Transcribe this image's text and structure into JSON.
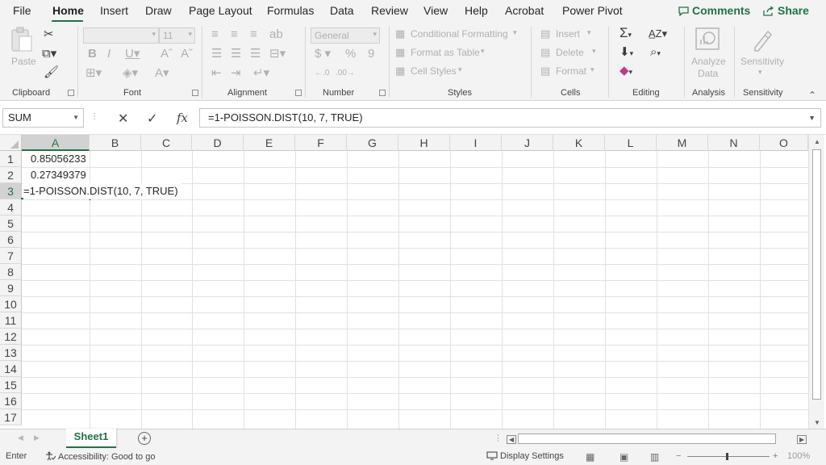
{
  "menu": {
    "tabs": [
      "File",
      "Home",
      "Insert",
      "Draw",
      "Page Layout",
      "Formulas",
      "Data",
      "Review",
      "View",
      "Help",
      "Acrobat",
      "Power Pivot"
    ],
    "active": "Home",
    "comments": "Comments",
    "share": "Share"
  },
  "ribbon": {
    "clipboard": {
      "label": "Clipboard",
      "paste": "Paste"
    },
    "font": {
      "label": "Font",
      "size": "11"
    },
    "alignment": {
      "label": "Alignment"
    },
    "number": {
      "label": "Number",
      "format": "General"
    },
    "styles": {
      "label": "Styles",
      "conditional": "Conditional Formatting",
      "format_table": "Format as Table",
      "cell_styles": "Cell Styles"
    },
    "cells": {
      "label": "Cells",
      "insert": "Insert",
      "delete": "Delete",
      "format": "Format"
    },
    "editing": {
      "label": "Editing"
    },
    "analysis": {
      "label": "Analysis",
      "analyze_data_line1": "Analyze",
      "analyze_data_line2": "Data"
    },
    "sensitivity": {
      "label": "Sensitivity",
      "button": "Sensitivity"
    }
  },
  "formula_bar": {
    "name_box": "SUM",
    "formula": "=1-POISSON.DIST(10, 7, TRUE)"
  },
  "grid": {
    "columns": [
      "A",
      "B",
      "C",
      "D",
      "E",
      "F",
      "G",
      "H",
      "I",
      "J",
      "K",
      "L",
      "M",
      "N",
      "O"
    ],
    "rows": [
      "1",
      "2",
      "3",
      "4",
      "5",
      "6",
      "7",
      "8",
      "9",
      "10",
      "11",
      "12",
      "13",
      "14",
      "15",
      "16",
      "17"
    ],
    "cells": {
      "A1": "0.85056233",
      "A2": "0.27349379",
      "A3": "=1-POISSON.DIST(10, 7, TRUE)"
    }
  },
  "sheets": {
    "active": "Sheet1"
  },
  "status": {
    "mode": "Enter",
    "accessibility": "Accessibility: Good to go",
    "display_settings": "Display Settings",
    "zoom": "100%"
  },
  "colors": {
    "accent": "#217346",
    "ribbon_bg": "#f3f3f3"
  }
}
